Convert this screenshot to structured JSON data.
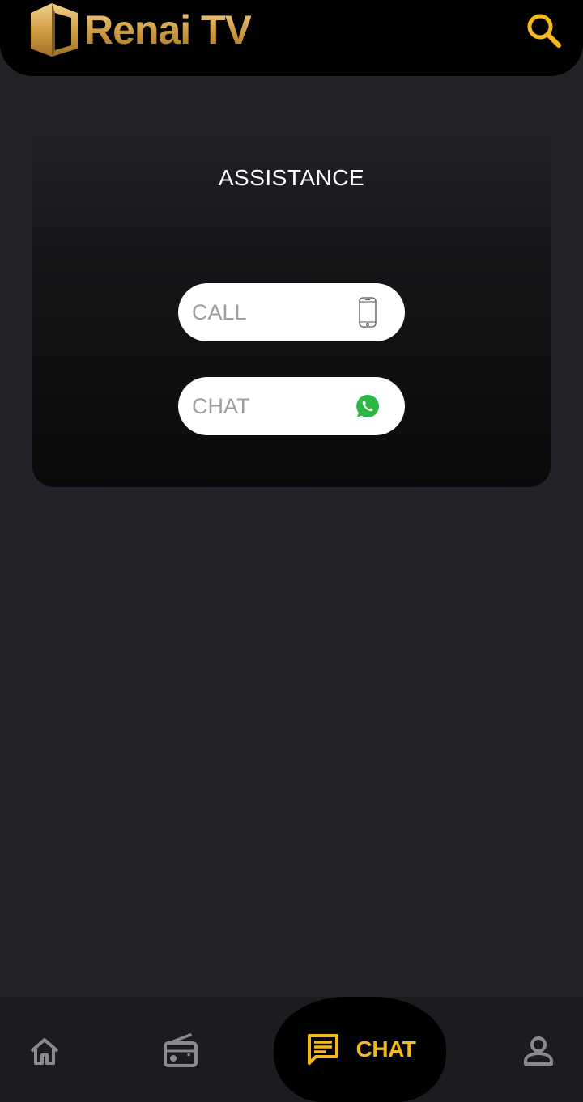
{
  "header": {
    "app_name": "Renai TV",
    "logo_icon": "renai-logo-mark",
    "search_icon": "search-icon",
    "accent": "#f5b91b"
  },
  "assistance": {
    "title": "ASSISTANCE",
    "call_label": "CALL",
    "call_icon": "phone-icon",
    "chat_label": "CHAT",
    "chat_icon": "whatsapp-icon"
  },
  "bottom_nav": {
    "items": [
      {
        "name": "home",
        "icon": "home-icon",
        "active": false
      },
      {
        "name": "radio",
        "icon": "radio-icon",
        "active": false
      },
      {
        "name": "chat",
        "icon": "chat-icon",
        "label": "CHAT",
        "active": true
      },
      {
        "name": "profile",
        "icon": "person-icon",
        "active": false
      }
    ],
    "active_color": "#f5b91b",
    "inactive_color": "#8a8a8e"
  }
}
